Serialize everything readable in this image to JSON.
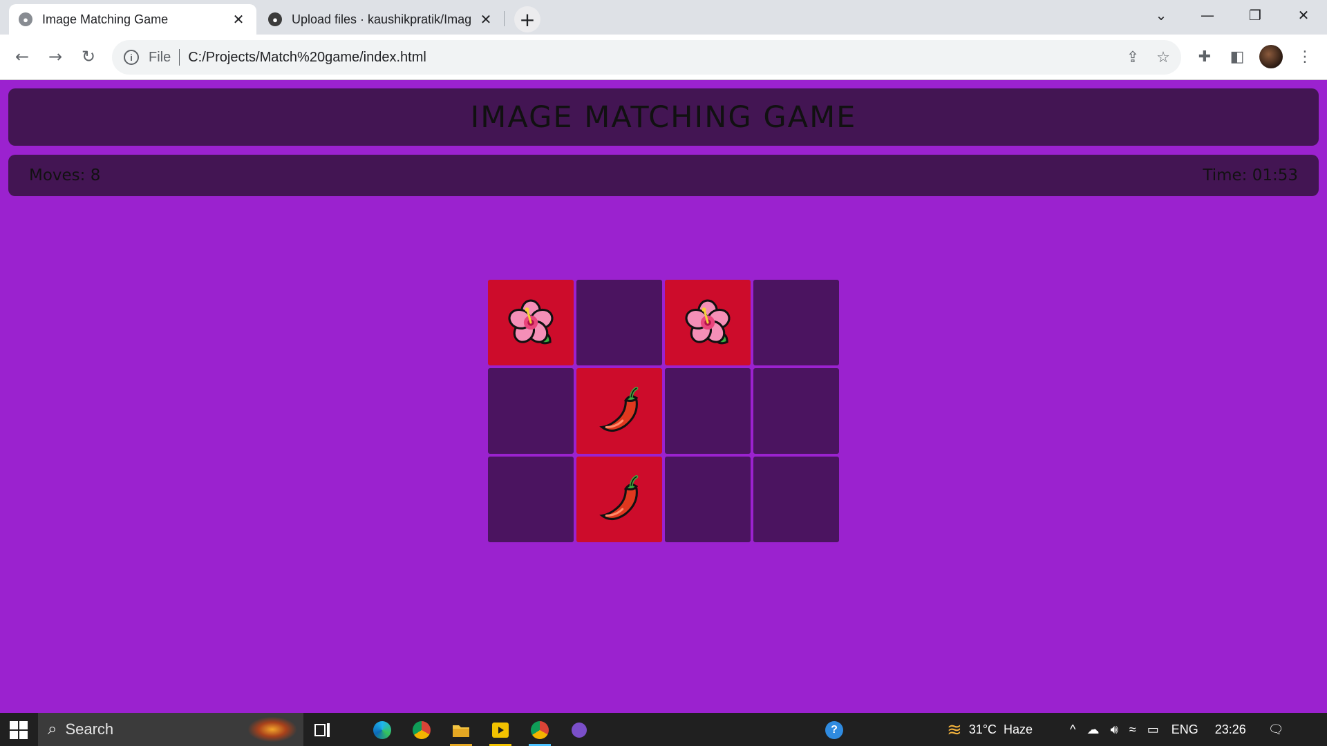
{
  "browser": {
    "tabs": [
      {
        "label": "Image Matching Game",
        "active": true
      },
      {
        "label": "Upload files · kaushikpratik/Imag",
        "active": false
      }
    ],
    "new_tab_label": "+",
    "address": {
      "scheme": "File",
      "url": "C:/Projects/Match%20game/index.html"
    }
  },
  "game": {
    "title": "IMAGE MATCHING GAME",
    "moves_label": "Moves: 8",
    "time_label": "Time: 01:53",
    "cards": [
      {
        "state": "revealed",
        "icon": "hibiscus-icon"
      },
      {
        "state": "hidden",
        "icon": ""
      },
      {
        "state": "revealed",
        "icon": "hibiscus-icon"
      },
      {
        "state": "hidden",
        "icon": ""
      },
      {
        "state": "hidden",
        "icon": ""
      },
      {
        "state": "revealed",
        "icon": "hot-pepper-icon"
      },
      {
        "state": "hidden",
        "icon": ""
      },
      {
        "state": "hidden",
        "icon": ""
      },
      {
        "state": "hidden",
        "icon": ""
      },
      {
        "state": "revealed",
        "icon": "hot-pepper-icon"
      },
      {
        "state": "hidden",
        "icon": ""
      },
      {
        "state": "hidden",
        "icon": ""
      }
    ],
    "colors": {
      "background": "#9b22cf",
      "panel": "#431553",
      "hidden_card": "#4b1460",
      "revealed_card": "#cd0c2b"
    }
  },
  "taskbar": {
    "search_placeholder": "Search",
    "weather": "31°C  Haze",
    "language": "ENG",
    "clock": "23:26"
  }
}
